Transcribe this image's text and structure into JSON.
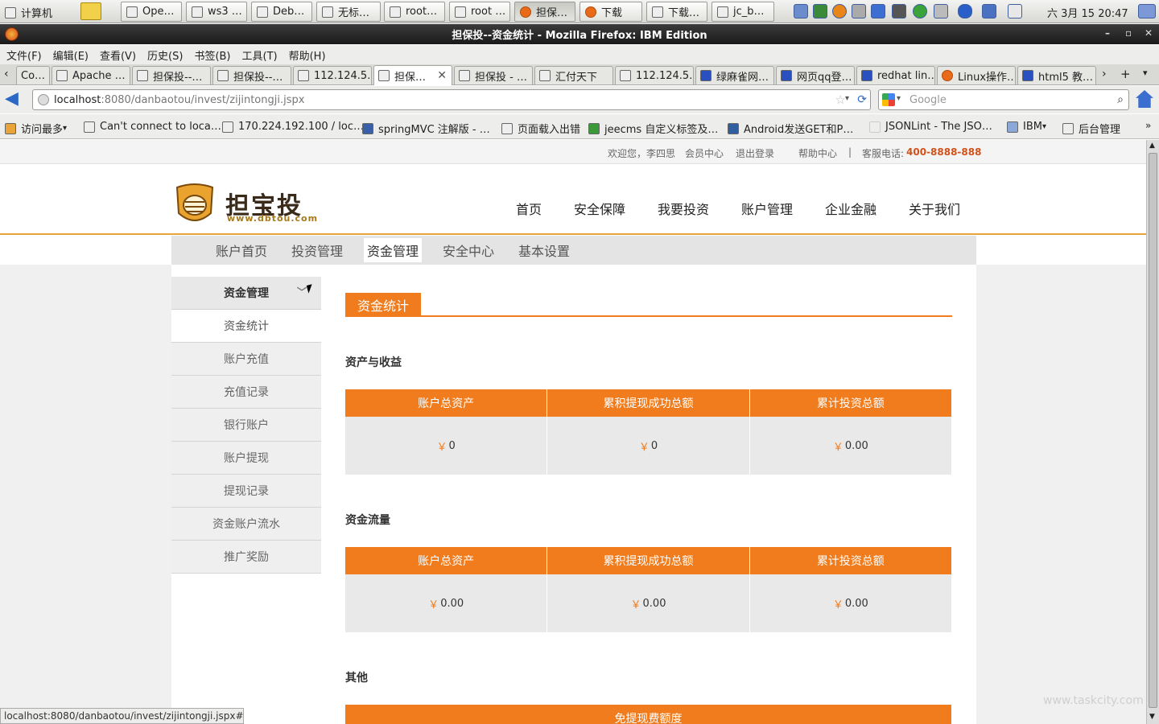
{
  "taskbar": {
    "start_label": "计算机",
    "tasks": [
      "Ope…",
      "ws3 …",
      "Deb…",
      "无标…",
      "root…",
      "root …",
      "担保…",
      "下载",
      "下载…",
      "jc_b…"
    ],
    "clock": "六 3月 15 20:47"
  },
  "window": {
    "title": "担保投--资金统计 - Mozilla Firefox: IBM Edition",
    "min": "–",
    "max": "▫",
    "close": "✕"
  },
  "menu": [
    "文件(F)",
    "编辑(E)",
    "查看(V)",
    "历史(S)",
    "书签(B)",
    "工具(T)",
    "帮助(H)"
  ],
  "tabs": [
    {
      "label": "Co…"
    },
    {
      "label": "Apache …"
    },
    {
      "label": "担保投--…"
    },
    {
      "label": "担保投--…"
    },
    {
      "label": "112.124.5…"
    },
    {
      "label": "担保…"
    },
    {
      "label": "担保投 - …"
    },
    {
      "label": "汇付天下"
    },
    {
      "label": "112.124.5…"
    },
    {
      "label": "绿麻雀网…"
    },
    {
      "label": "网页qq登…"
    },
    {
      "label": "redhat lin…"
    },
    {
      "label": "Linux操作…"
    },
    {
      "label": "html5 教…"
    }
  ],
  "nav": {
    "url_host": "localhost",
    "url_path": ":8080/danbaotou/invest/zijintongji.jspx",
    "search_placeholder": "Google"
  },
  "bookmarks": [
    "访问最多",
    "Can't connect to loca…",
    "170.224.192.100 / loc…",
    "springMVC 注解版 - …",
    "页面载入出错",
    "jeecms 自定义标签及…",
    "Android发送GET和P…",
    "JSONLint - The JSO…",
    "IBM",
    "后台管理"
  ],
  "site": {
    "topbar": {
      "welcome": "欢迎您，李四思",
      "member": "会员中心",
      "logout": "退出登录",
      "help": "帮助中心",
      "sep": "|",
      "hotline_label": "客服电话:",
      "hotline": "400-8888-888"
    },
    "logo_text": "担宝投",
    "logo_url": "www.dbtou.com",
    "mainnav": [
      "首页",
      "安全保障",
      "我要投资",
      "账户管理",
      "企业金融",
      "关于我们"
    ],
    "subnav": [
      "账户首页",
      "投资管理",
      "资金管理",
      "安全中心",
      "基本设置"
    ],
    "sidebar": {
      "head": "资金管理",
      "items": [
        "资金统计",
        "账户充值",
        "充值记录",
        "银行账户",
        "账户提现",
        "提现记录",
        "资金账户流水",
        "推广奖励"
      ]
    },
    "content": {
      "title": "资金统计",
      "yen": "￥",
      "sections": [
        {
          "title": "资产与收益",
          "headers": [
            "账户总资产",
            "累积提现成功总额",
            "累计投资总额"
          ],
          "values": [
            "0",
            "0",
            "0.00"
          ]
        },
        {
          "title": "资金流量",
          "headers": [
            "账户总资产",
            "累积提现成功总额",
            "累计投资总额"
          ],
          "values": [
            "0.00",
            "0.00",
            "0.00"
          ]
        },
        {
          "title": "其他",
          "headers": [
            "免提现费额度"
          ],
          "values": []
        }
      ]
    }
  },
  "statusbar": "localhost:8080/danbaotou/invest/zijintongji.jspx#",
  "watermark": "www.taskcity.com"
}
